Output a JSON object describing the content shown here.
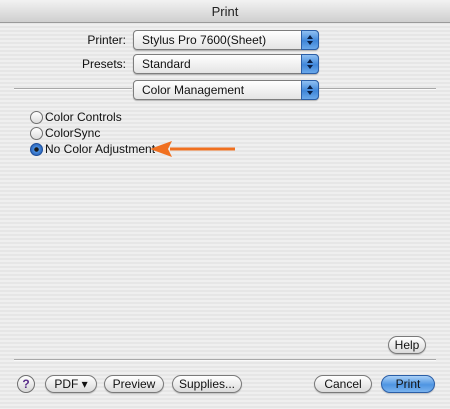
{
  "window": {
    "title": "Print"
  },
  "printer": {
    "label": "Printer:",
    "value": "Stylus Pro 7600(Sheet)"
  },
  "presets": {
    "label": "Presets:",
    "value": "Standard"
  },
  "panel": {
    "value": "Color Management"
  },
  "options": [
    {
      "label": "Color Controls",
      "checked": false
    },
    {
      "label": "ColorSync",
      "checked": false
    },
    {
      "label": "No Color Adjustment",
      "checked": true
    }
  ],
  "annotation": {
    "arrow_color": "#f07020"
  },
  "buttons": {
    "help": "Help",
    "question": "?",
    "pdf": "PDF ▾",
    "preview": "Preview",
    "supplies": "Supplies...",
    "cancel": "Cancel",
    "print": "Print"
  }
}
